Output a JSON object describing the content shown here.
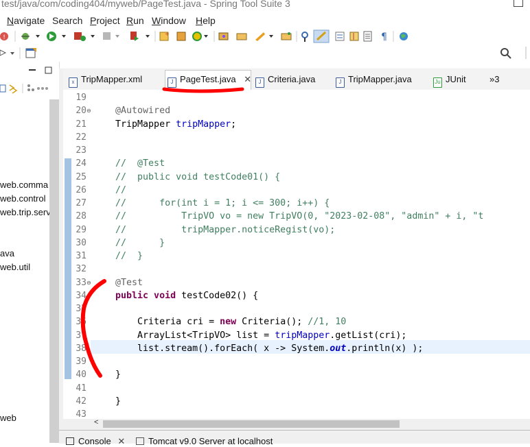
{
  "window": {
    "title": "test/java/com/coding404/myweb/PageTest.java - Spring Tool Suite 3"
  },
  "menu": [
    {
      "pre": "",
      "u": "N",
      "post": "avigate"
    },
    {
      "pre": "",
      "u": "",
      "post": "Search"
    },
    {
      "pre": "",
      "u": "P",
      "post": "roject"
    },
    {
      "pre": "",
      "u": "R",
      "post": "un"
    },
    {
      "pre": "",
      "u": "W",
      "post": "indow"
    },
    {
      "pre": "",
      "u": "H",
      "post": "elp"
    }
  ],
  "menu_labels": [
    "Navigate",
    "Search",
    "Project",
    "Run",
    "Window",
    "Help"
  ],
  "toolbar_icons": [
    "error-icon",
    "debug-icon",
    "run-icon",
    "coverage-icon",
    "stop-icon",
    "run-ext-icon",
    "new-project-icon",
    "open-type-icon",
    "refresh-icon",
    "package-icon",
    "folder-open-icon",
    "deploy-icon",
    "open-folder-icon",
    "search-toggle-icon",
    "highlight-icon",
    "task-icon",
    "properties-icon",
    "paragraph-icon",
    "globe-icon"
  ],
  "left_panel": {
    "items": [
      "web.comma",
      "web.control",
      "web.trip.serv",
      "ava",
      "web.util",
      "web"
    ]
  },
  "editor_tabs": [
    {
      "label": "TripMapper.xml",
      "icon": "xml-file-icon",
      "active": false
    },
    {
      "label": "PageTest.java",
      "icon": "java-file-icon",
      "active": true
    },
    {
      "label": "Criteria.java",
      "icon": "java-file-icon",
      "active": false
    },
    {
      "label": "TripMapper.java",
      "icon": "java-file-icon",
      "active": false
    },
    {
      "label": "JUnit",
      "icon": "junit-icon",
      "active": false
    },
    {
      "label": "»3",
      "icon": "",
      "active": false
    }
  ],
  "close_glyph": "✕",
  "code_lines": [
    {
      "n": "19",
      "fold": "",
      "parts": []
    },
    {
      "n": "20",
      "fold": "⊖",
      "parts": [
        [
          "ann",
          "    @Autowired"
        ]
      ]
    },
    {
      "n": "21",
      "fold": "",
      "parts": [
        [
          "plain",
          "    TripMapper "
        ],
        [
          "fld",
          "tripMapper"
        ],
        [
          "plain",
          ";"
        ]
      ]
    },
    {
      "n": "22",
      "fold": "",
      "parts": []
    },
    {
      "n": "23",
      "fold": "",
      "parts": []
    },
    {
      "n": "24",
      "fold": "",
      "parts": [
        [
          "cmt",
          "    //  @Test"
        ]
      ]
    },
    {
      "n": "25",
      "fold": "",
      "parts": [
        [
          "cmt",
          "    //  public void testCode01() {"
        ]
      ]
    },
    {
      "n": "26",
      "fold": "",
      "parts": [
        [
          "cmt",
          "    //"
        ]
      ]
    },
    {
      "n": "27",
      "fold": "",
      "parts": [
        [
          "cmt",
          "    //      for(int i = 1; i <= 300; i++) {"
        ]
      ]
    },
    {
      "n": "28",
      "fold": "",
      "parts": [
        [
          "cmt",
          "    //          TripVO vo = new TripVO(0, \"2023-02-08\", \"admin\" + i, \"t"
        ]
      ]
    },
    {
      "n": "29",
      "fold": "",
      "parts": [
        [
          "cmt",
          "    //          tripMapper.noticeRegist(vo);"
        ]
      ]
    },
    {
      "n": "30",
      "fold": "",
      "parts": [
        [
          "cmt",
          "    //      }"
        ]
      ]
    },
    {
      "n": "31",
      "fold": "",
      "parts": [
        [
          "cmt",
          "    //  }"
        ]
      ]
    },
    {
      "n": "32",
      "fold": "",
      "parts": []
    },
    {
      "n": "33",
      "fold": "⊖",
      "parts": [
        [
          "ann",
          "    @Test"
        ]
      ]
    },
    {
      "n": "34",
      "fold": "",
      "parts": [
        [
          "kw",
          "    public void "
        ],
        [
          "plain",
          "testCode02() {"
        ]
      ]
    },
    {
      "n": "35",
      "fold": "",
      "parts": []
    },
    {
      "n": "36",
      "fold": "",
      "parts": [
        [
          "plain",
          "        Criteria cri = "
        ],
        [
          "kw",
          "new "
        ],
        [
          "plain",
          "Criteria(); "
        ],
        [
          "cmt",
          "//1, 10"
        ]
      ]
    },
    {
      "n": "37",
      "fold": "",
      "parts": [
        [
          "plain",
          "        ArrayList<TripVO> list = "
        ],
        [
          "fld",
          "tripMapper"
        ],
        [
          "plain",
          ".getList(cri);"
        ]
      ]
    },
    {
      "n": "38",
      "fold": "",
      "parts": [
        [
          "plain",
          "        list.stream().forEach( x -> System."
        ],
        [
          "sfld",
          "out"
        ],
        [
          "plain",
          ".println(x) );"
        ]
      ]
    },
    {
      "n": "39",
      "fold": "",
      "parts": []
    },
    {
      "n": "40",
      "fold": "",
      "parts": [
        [
          "plain",
          "    }"
        ]
      ]
    },
    {
      "n": "41",
      "fold": "",
      "parts": []
    },
    {
      "n": "42",
      "fold": "",
      "parts": [
        [
          "plain",
          "    }"
        ]
      ]
    },
    {
      "n": "43",
      "fold": "",
      "parts": []
    }
  ],
  "bottom_tabs": [
    "Console",
    "Tomcat v9.0 Server at localhost"
  ],
  "colors": {
    "annotation_red": "#ff0000",
    "change_bar": "#5a8fc8",
    "current_line": "#e8f2fe"
  }
}
